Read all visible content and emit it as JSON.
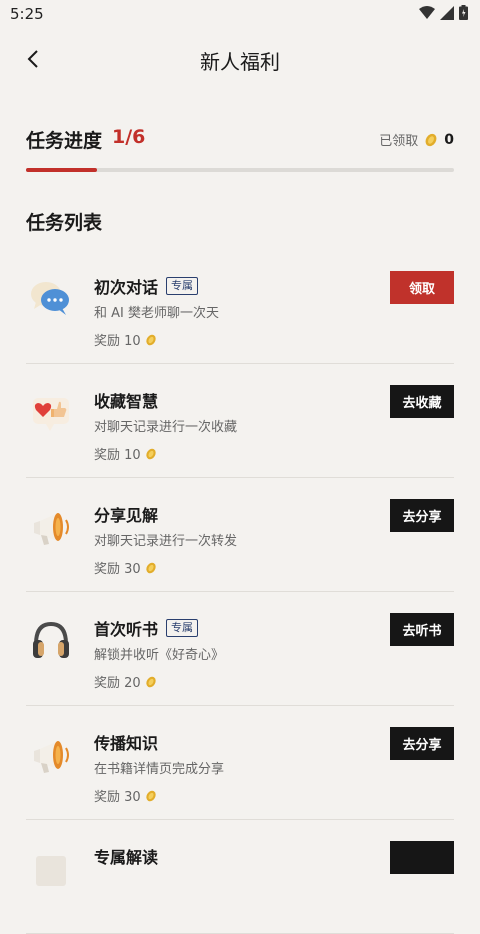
{
  "status": {
    "time": "5:25"
  },
  "header": {
    "title": "新人福利"
  },
  "progress": {
    "label": "任务进度",
    "value": "1/6",
    "fraction": 0.1667,
    "claimed_label": "已领取",
    "claimed_count": "0"
  },
  "section": {
    "title": "任务列表"
  },
  "tasks": [
    {
      "name": "初次对话",
      "tag": "专属",
      "desc": "和 AI 樊老师聊一次天",
      "reward": "奖励 10",
      "button": "领取",
      "icon": "chat-bubbles-icon"
    },
    {
      "name": "收藏智慧",
      "tag": "",
      "desc": "对聊天记录进行一次收藏",
      "reward": "奖励 10",
      "button": "去收藏",
      "icon": "heart-thumbs-up-icon"
    },
    {
      "name": "分享见解",
      "tag": "",
      "desc": "对聊天记录进行一次转发",
      "reward": "奖励 30",
      "button": "去分享",
      "icon": "megaphone-icon"
    },
    {
      "name": "首次听书",
      "tag": "专属",
      "desc": "解锁并收听《好奇心》",
      "reward": "奖励 20",
      "button": "去听书",
      "icon": "headphones-icon"
    },
    {
      "name": "传播知识",
      "tag": "",
      "desc": "在书籍详情页完成分享",
      "reward": "奖励 30",
      "button": "去分享",
      "icon": "megaphone-icon"
    },
    {
      "name": "专属解读",
      "tag": "",
      "desc": "",
      "reward": "",
      "button": "",
      "icon": "book-icon"
    }
  ],
  "colors": {
    "accent": "#c2302a",
    "dark_button": "#161616",
    "background": "#f4f2ef",
    "tag": "#2a3f6e"
  }
}
